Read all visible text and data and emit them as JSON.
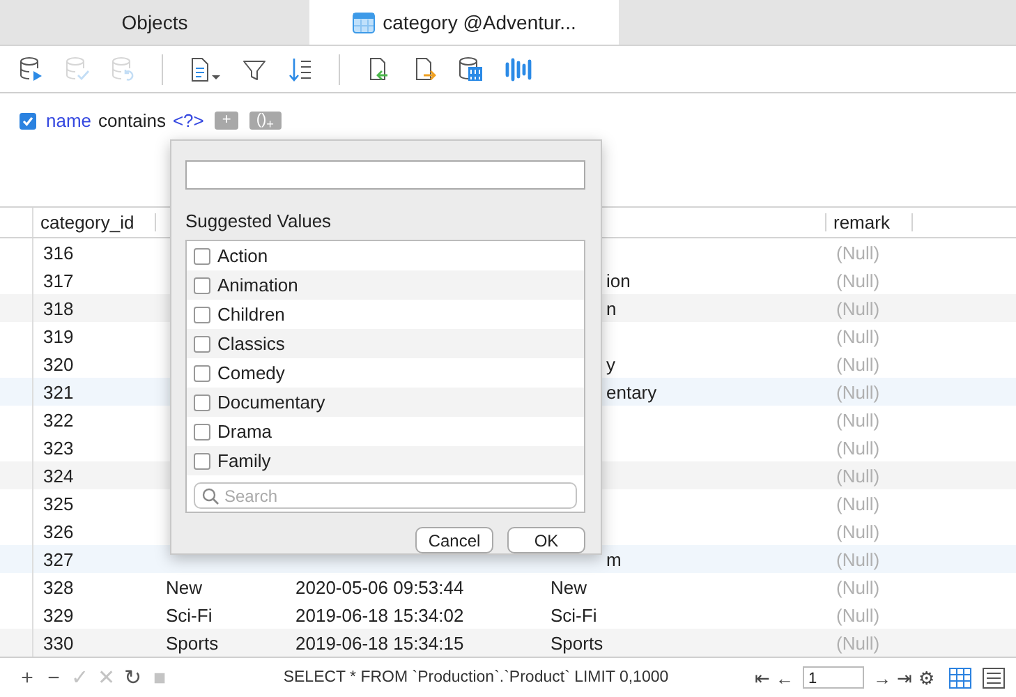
{
  "tabs": [
    {
      "label": "Objects",
      "selected": false,
      "icon": false
    },
    {
      "label": "category @Adventur...",
      "selected": true,
      "icon": true
    }
  ],
  "toolbar": [
    {
      "kind": "db-run",
      "disabled": false
    },
    {
      "kind": "db-check",
      "disabled": true
    },
    {
      "kind": "db-undo",
      "disabled": true
    },
    {
      "kind": "sep"
    },
    {
      "kind": "doc",
      "disabled": false
    },
    {
      "kind": "filter",
      "disabled": false
    },
    {
      "kind": "sort",
      "disabled": false
    },
    {
      "kind": "sep"
    },
    {
      "kind": "import",
      "disabled": false
    },
    {
      "kind": "export",
      "disabled": false
    },
    {
      "kind": "db-data",
      "disabled": false
    },
    {
      "kind": "chart",
      "disabled": false
    }
  ],
  "filter": {
    "checked": true,
    "field": "name",
    "operator": "contains",
    "value": "<?>",
    "buttons": [
      "+",
      "()$_{+}$"
    ]
  },
  "table": {
    "columns": [
      "category_id",
      null,
      null,
      null,
      "remark"
    ],
    "rows": [
      {
        "kind": "plain",
        "cells": [
          "316",
          null,
          null,
          null,
          "(Null)"
        ]
      },
      {
        "kind": "plain",
        "cells": [
          "317",
          null,
          null,
          "ion",
          "(Null)"
        ]
      },
      {
        "kind": "striped",
        "cells": [
          "318",
          null,
          null,
          "n",
          "(Null)"
        ]
      },
      {
        "kind": "plain",
        "cells": [
          "319",
          null,
          null,
          null,
          "(Null)"
        ]
      },
      {
        "kind": "plain",
        "cells": [
          "320",
          null,
          null,
          "y",
          "(Null)"
        ]
      },
      {
        "kind": "highlighted",
        "cells": [
          "321",
          null,
          null,
          "entary",
          "(Null)"
        ]
      },
      {
        "kind": "plain",
        "cells": [
          "322",
          null,
          null,
          null,
          "(Null)"
        ]
      },
      {
        "kind": "plain",
        "cells": [
          "323",
          null,
          null,
          null,
          "(Null)"
        ]
      },
      {
        "kind": "striped",
        "cells": [
          "324",
          null,
          null,
          null,
          "(Null)"
        ]
      },
      {
        "kind": "plain",
        "cells": [
          "325",
          null,
          null,
          null,
          "(Null)"
        ]
      },
      {
        "kind": "plain",
        "cells": [
          "326",
          null,
          null,
          null,
          "(Null)"
        ]
      },
      {
        "kind": "highlighted",
        "cells": [
          "327",
          null,
          null,
          "m",
          "(Null)"
        ]
      },
      {
        "kind": "plain",
        "cells": [
          "328",
          "New",
          "2020-05-06 09:53:44",
          "New",
          "(Null)"
        ]
      },
      {
        "kind": "plain",
        "cells": [
          "329",
          "Sci-Fi",
          "2019-06-18 15:34:02",
          "Sci-Fi",
          "(Null)"
        ]
      },
      {
        "kind": "striped",
        "cells": [
          "330",
          "Sports",
          "2019-06-18 15:34:15",
          "Sports",
          "(Null)"
        ]
      }
    ]
  },
  "popup": {
    "heading": "Suggested Values",
    "search": {
      "placeholder": "Search"
    },
    "values": [
      {
        "label": "Action",
        "checked": false
      },
      {
        "label": "Animation",
        "checked": false
      },
      {
        "label": "Children",
        "checked": false
      },
      {
        "label": "Classics",
        "checked": false
      },
      {
        "label": "Comedy",
        "checked": false
      },
      {
        "label": "Documentary",
        "checked": false
      },
      {
        "label": "Drama",
        "checked": false
      },
      {
        "label": "Family",
        "checked": false
      }
    ],
    "buttons": [
      "Cancel",
      "OK"
    ]
  },
  "status_bar": {
    "actions": [
      {
        "label": "+",
        "disabled": false
      },
      {
        "label": "−",
        "disabled": false
      },
      {
        "label": "✓",
        "disabled": true
      },
      {
        "label": "✕",
        "disabled": true
      },
      {
        "label": "↻",
        "disabled": false
      },
      {
        "label": "■",
        "disabled": true
      }
    ],
    "query": "SELECT * FROM `Production`.`Product` LIMIT 0,1000",
    "nav_left": [
      "⇤",
      "←"
    ],
    "page": "1",
    "nav_right": [
      "→",
      "⇥",
      "⚙"
    ],
    "views": [
      {
        "kind": "grid",
        "selected": true
      },
      {
        "kind": "form",
        "selected": false
      }
    ]
  }
}
